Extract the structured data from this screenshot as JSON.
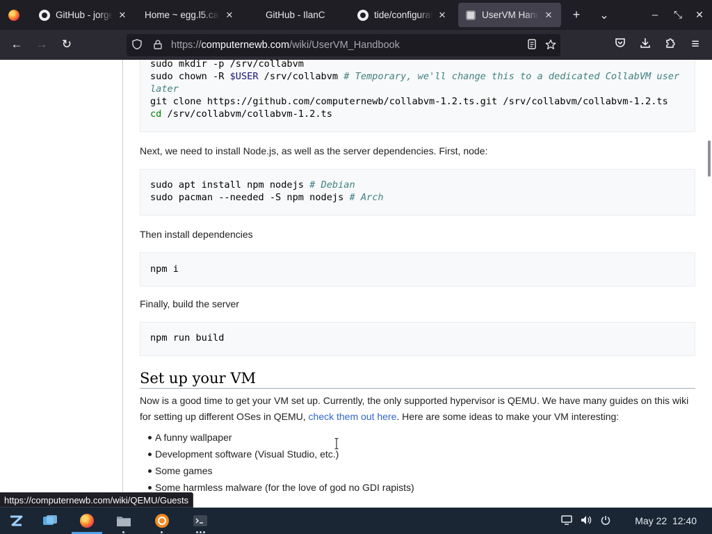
{
  "browser": {
    "tabs": [
      {
        "title": "GitHub - jorge",
        "icon": "github-icon",
        "active": false
      },
      {
        "title": "Home ~ egg.l5.ca",
        "icon": "none",
        "active": false
      },
      {
        "title": "GitHub - IlanC",
        "icon": "none",
        "active": false
      },
      {
        "title": "tide/configurat",
        "icon": "github-icon",
        "active": false
      },
      {
        "title": "UserVM Handb",
        "icon": "wiki-icon",
        "active": true
      }
    ],
    "new_tab_glyph": "+",
    "list_tabs_glyph": "⌄",
    "window_minimize_glyph": "–",
    "window_restore_glyph": "⤡",
    "window_close_glyph": "✕",
    "tab_close_glyph": "✕",
    "url": {
      "scheme": "https://",
      "host": "computernewb.com",
      "path": "/wiki/UserVM_Handbook"
    },
    "nav": {
      "back_glyph": "←",
      "forward_glyph": "→",
      "reload_glyph": "↻",
      "menu_glyph": "≡"
    }
  },
  "page": {
    "code_block_1": [
      [
        {
          "t": "sudo mkdir -p /srv/collabvm",
          "c": "plain"
        }
      ],
      [
        {
          "t": "sudo chown -R ",
          "c": "plain"
        },
        {
          "t": "$USER",
          "c": "var"
        },
        {
          "t": " /srv/collabvm ",
          "c": "plain"
        },
        {
          "t": "# Temporary, we'll change this to a dedicated CollabVM user later",
          "c": "comment"
        }
      ],
      [
        {
          "t": "git clone https://github.com/computernewb/collabvm-1.2.ts.git /srv/collabvm/collabvm-1.2.ts",
          "c": "plain"
        }
      ],
      [
        {
          "t": "cd",
          "c": "kw"
        },
        {
          "t": " /srv/collabvm/collabvm-1.2.ts",
          "c": "plain"
        }
      ]
    ],
    "para_node": "Next, we need to install Node.js, as well as the server dependencies. First, node:",
    "code_block_2": [
      [
        {
          "t": "sudo apt install npm nodejs ",
          "c": "plain"
        },
        {
          "t": "# Debian",
          "c": "comment"
        }
      ],
      [
        {
          "t": "sudo pacman --needed -S npm nodejs ",
          "c": "plain"
        },
        {
          "t": "# Arch",
          "c": "comment"
        }
      ]
    ],
    "para_deps": "Then install dependencies",
    "code_block_3": [
      [
        {
          "t": "npm i",
          "c": "plain"
        }
      ]
    ],
    "para_build": "Finally, build the server",
    "code_block_4": [
      [
        {
          "t": "npm run build",
          "c": "plain"
        }
      ]
    ],
    "heading_vm": "Set up your VM",
    "para_vm_before": "Now is a good time to get your VM set up. Currently, the only supported hypervisor is QEMU. We have many guides on this wiki for setting up different OSes in QEMU, ",
    "para_vm_link": "check them out here",
    "para_vm_after": ". Here are some ideas to make your VM interesting:",
    "ideas": [
      "A funny wallpaper",
      "Development software (Visual Studio, etc.)",
      "Some games",
      "Some harmless malware (for the love of god no GDI rapists)"
    ]
  },
  "status_link": "https://computernewb.com/wiki/QEMU/Guests",
  "taskbar": {
    "apps": [
      "app-menu-icon",
      "workspaces-icon",
      "firefox-icon",
      "files-icon",
      "software-icon",
      "terminal-icon"
    ],
    "date": "May 22",
    "time": "12:40"
  },
  "colors": {
    "accent": "#3366cc",
    "taskbar": "#1a2633",
    "tabbar": "#1f1e25"
  }
}
